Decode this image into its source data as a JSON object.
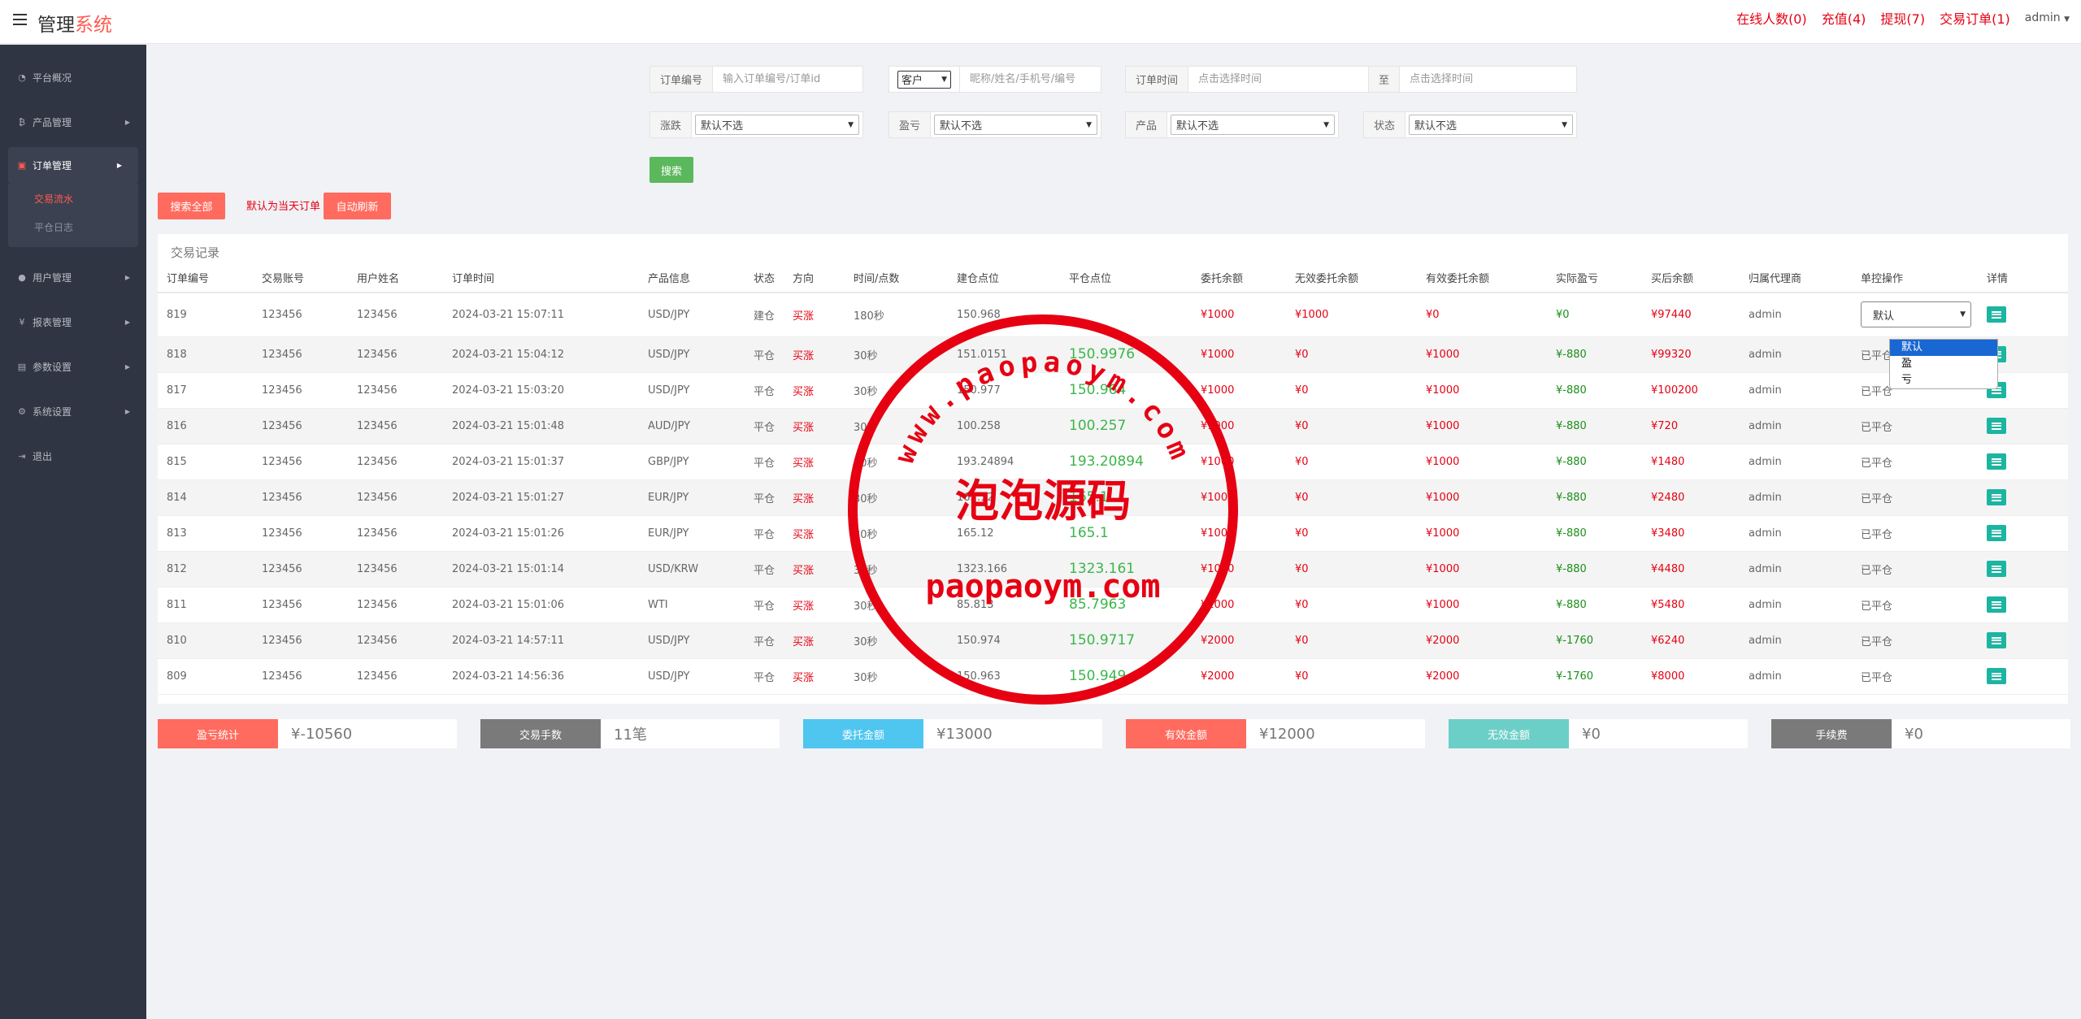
{
  "brand": {
    "part1": "管理",
    "part2": "系统"
  },
  "topnav": {
    "online": "在线人数(0)",
    "recharge": "充值(4)",
    "withdraw": "提现(7)",
    "trade_orders": "交易订单(1)",
    "admin": "admin"
  },
  "sidebar": {
    "items": [
      {
        "label": "平台概况",
        "icon": "dashboard-icon"
      },
      {
        "label": "产品管理",
        "icon": "bitcoin-icon"
      },
      {
        "label": "订单管理",
        "icon": "orders-icon"
      },
      {
        "label": "用户管理",
        "icon": "user-icon"
      },
      {
        "label": "报表管理",
        "icon": "yen-icon"
      },
      {
        "label": "参数设置",
        "icon": "params-icon"
      },
      {
        "label": "系统设置",
        "icon": "gears-icon"
      },
      {
        "label": "退出",
        "icon": "logout-icon"
      }
    ],
    "subitems": [
      "交易流水",
      "平仓日志"
    ]
  },
  "filters": {
    "order_no_label": "订单编号",
    "order_no_placeholder": "输入订单编号/订单id",
    "customer_select": "客户",
    "customer_placeholder": "昵称/姓名/手机号/编号",
    "time_label": "订单时间",
    "time_start_placeholder": "点击选择时间",
    "to_label": "至",
    "time_end_placeholder": "点击选择时间",
    "rise_label": "涨跌",
    "pl_label": "盈亏",
    "product_label": "产品",
    "status_label": "状态",
    "default_option": "默认不选",
    "search_button": "搜索"
  },
  "actions": {
    "search_all": "搜索全部",
    "default_note": "默认为当天订单",
    "auto_refresh": "自动刷新"
  },
  "table": {
    "title": "交易记录",
    "headers": [
      "订单编号",
      "交易账号",
      "用户姓名",
      "订单时间",
      "产品信息",
      "状态",
      "方向",
      "时间/点数",
      "建仓点位",
      "平仓点位",
      "委托余额",
      "无效委托余额",
      "有效委托余额",
      "实际盈亏",
      "买后余额",
      "归属代理商",
      "单控操作",
      "详情"
    ],
    "rows": [
      {
        "id": "819",
        "account": "123456",
        "name": "123456",
        "time": "2024-03-21 15:07:11",
        "product": "USD/JPY",
        "status": "建仓",
        "direction": "买涨",
        "period": "180秒",
        "open": "150.968",
        "close": "",
        "amount": "¥1000",
        "invalid": "¥1000",
        "valid": "¥0",
        "pnl": "¥0",
        "after": "¥97440",
        "agent": "admin",
        "op": "默认"
      },
      {
        "id": "818",
        "account": "123456",
        "name": "123456",
        "time": "2024-03-21 15:04:12",
        "product": "USD/JPY",
        "status": "平仓",
        "direction": "买涨",
        "period": "30秒",
        "open": "151.0151",
        "close": "150.9976",
        "amount": "¥1000",
        "invalid": "¥0",
        "valid": "¥1000",
        "pnl": "¥-880",
        "after": "¥99320",
        "agent": "admin",
        "op": "已平仓"
      },
      {
        "id": "817",
        "account": "123456",
        "name": "123456",
        "time": "2024-03-21 15:03:20",
        "product": "USD/JPY",
        "status": "平仓",
        "direction": "买涨",
        "period": "30秒",
        "open": "150.977",
        "close": "150.964",
        "amount": "¥1000",
        "invalid": "¥0",
        "valid": "¥1000",
        "pnl": "¥-880",
        "after": "¥100200",
        "agent": "admin",
        "op": "已平仓"
      },
      {
        "id": "816",
        "account": "123456",
        "name": "123456",
        "time": "2024-03-21 15:01:48",
        "product": "AUD/JPY",
        "status": "平仓",
        "direction": "买涨",
        "period": "30秒",
        "open": "100.258",
        "close": "100.257",
        "amount": "¥1000",
        "invalid": "¥0",
        "valid": "¥1000",
        "pnl": "¥-880",
        "after": "¥720",
        "agent": "admin",
        "op": "已平仓"
      },
      {
        "id": "815",
        "account": "123456",
        "name": "123456",
        "time": "2024-03-21 15:01:37",
        "product": "GBP/JPY",
        "status": "平仓",
        "direction": "买涨",
        "period": "30秒",
        "open": "193.24894",
        "close": "193.20894",
        "amount": "¥1000",
        "invalid": "¥0",
        "valid": "¥1000",
        "pnl": "¥-880",
        "after": "¥1480",
        "agent": "admin",
        "op": "已平仓"
      },
      {
        "id": "814",
        "account": "123456",
        "name": "123456",
        "time": "2024-03-21 15:01:27",
        "product": "EUR/JPY",
        "status": "平仓",
        "direction": "买涨",
        "period": "30秒",
        "open": "165.12",
        "close": "165.1",
        "amount": "¥1000",
        "invalid": "¥0",
        "valid": "¥1000",
        "pnl": "¥-880",
        "after": "¥2480",
        "agent": "admin",
        "op": "已平仓"
      },
      {
        "id": "813",
        "account": "123456",
        "name": "123456",
        "time": "2024-03-21 15:01:26",
        "product": "EUR/JPY",
        "status": "平仓",
        "direction": "买涨",
        "period": "30秒",
        "open": "165.12",
        "close": "165.1",
        "amount": "¥1000",
        "invalid": "¥0",
        "valid": "¥1000",
        "pnl": "¥-880",
        "after": "¥3480",
        "agent": "admin",
        "op": "已平仓"
      },
      {
        "id": "812",
        "account": "123456",
        "name": "123456",
        "time": "2024-03-21 15:01:14",
        "product": "USD/KRW",
        "status": "平仓",
        "direction": "买涨",
        "period": "30秒",
        "open": "1323.166",
        "close": "1323.161",
        "amount": "¥1000",
        "invalid": "¥0",
        "valid": "¥1000",
        "pnl": "¥-880",
        "after": "¥4480",
        "agent": "admin",
        "op": "已平仓"
      },
      {
        "id": "811",
        "account": "123456",
        "name": "123456",
        "time": "2024-03-21 15:01:06",
        "product": "WTI",
        "status": "平仓",
        "direction": "买涨",
        "period": "30秒",
        "open": "85.813",
        "close": "85.7963",
        "amount": "¥1000",
        "invalid": "¥0",
        "valid": "¥1000",
        "pnl": "¥-880",
        "after": "¥5480",
        "agent": "admin",
        "op": "已平仓"
      },
      {
        "id": "810",
        "account": "123456",
        "name": "123456",
        "time": "2024-03-21 14:57:11",
        "product": "USD/JPY",
        "status": "平仓",
        "direction": "买涨",
        "period": "30秒",
        "open": "150.974",
        "close": "150.9717",
        "amount": "¥2000",
        "invalid": "¥0",
        "valid": "¥2000",
        "pnl": "¥-1760",
        "after": "¥6240",
        "agent": "admin",
        "op": "已平仓"
      },
      {
        "id": "809",
        "account": "123456",
        "name": "123456",
        "time": "2024-03-21 14:56:36",
        "product": "USD/JPY",
        "status": "平仓",
        "direction": "买涨",
        "period": "30秒",
        "open": "150.963",
        "close": "150.949",
        "amount": "¥2000",
        "invalid": "¥0",
        "valid": "¥2000",
        "pnl": "¥-1760",
        "after": "¥8000",
        "agent": "admin",
        "op": "已平仓"
      }
    ]
  },
  "dropdown": {
    "options": [
      "默认",
      "盈",
      "亏"
    ]
  },
  "stats": [
    {
      "label": "盈亏统计",
      "value": "¥-10560",
      "color": "#ff6b5e"
    },
    {
      "label": "交易手数",
      "value": "11笔",
      "color": "#7a7a7a"
    },
    {
      "label": "委托金额",
      "value": "¥13000",
      "color": "#4fc6f0"
    },
    {
      "label": "有效金额",
      "value": "¥12000",
      "color": "#ff6b5e"
    },
    {
      "label": "无效金额",
      "value": "¥0",
      "color": "#6ccfc7"
    },
    {
      "label": "手续费",
      "value": "¥0",
      "color": "#7a7a7a"
    }
  ],
  "watermark": {
    "top": "www.paopaoym.com",
    "middle": "泡泡源码",
    "bottom": "paopaoym.com"
  }
}
